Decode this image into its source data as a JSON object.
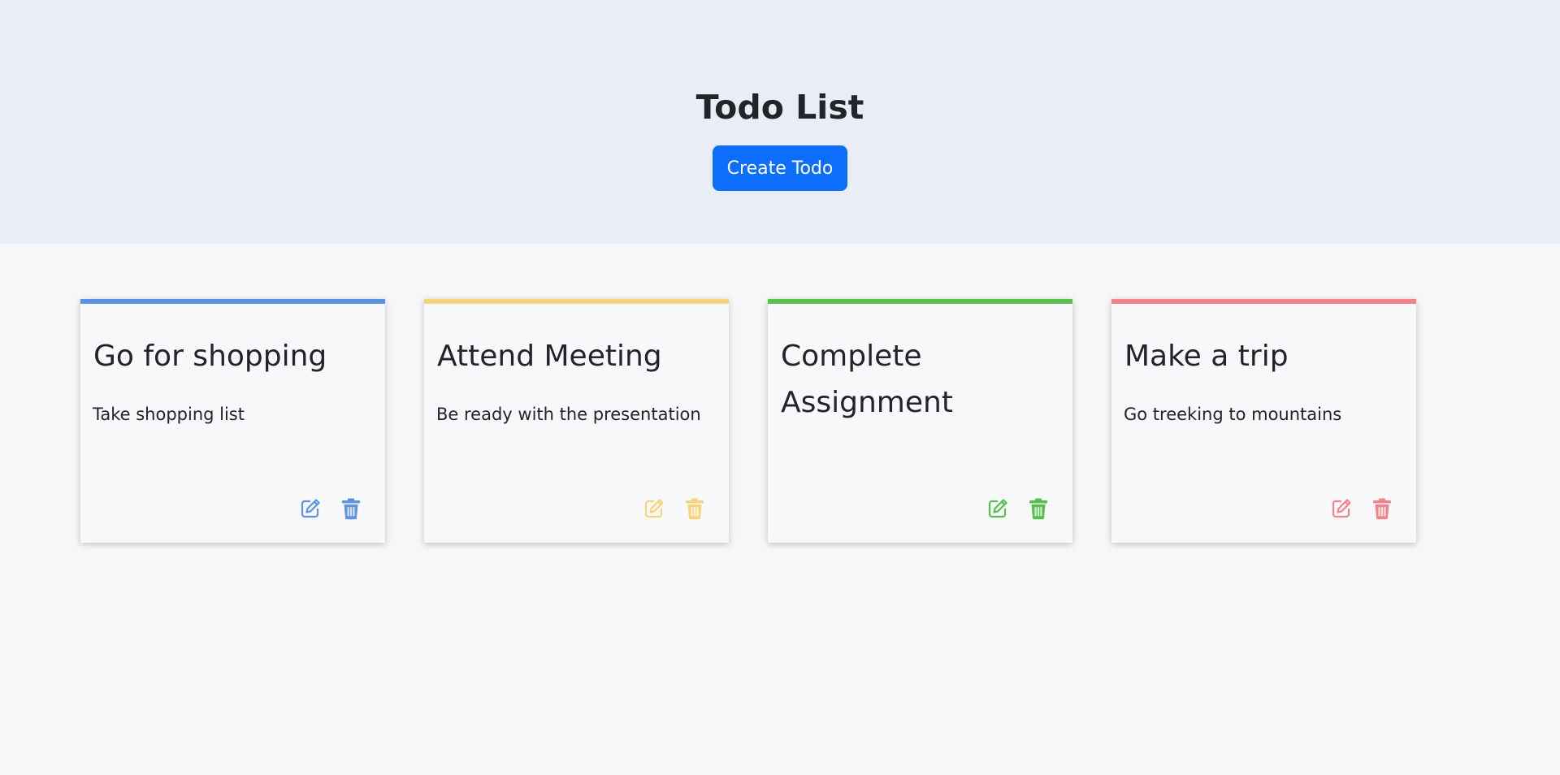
{
  "header": {
    "title": "Todo List",
    "create_label": "Create Todo"
  },
  "todos": [
    {
      "title": "Go for shopping",
      "description": "Take shopping list",
      "color": "#5b93e0",
      "edit_icon": "edit-icon",
      "delete_icon": "trash-icon"
    },
    {
      "title": "Attend Meeting",
      "description": "Be ready with the presentation",
      "color": "#f7d47c",
      "edit_icon": "edit-icon",
      "delete_icon": "trash-icon"
    },
    {
      "title": "Complete Assignment",
      "description": "",
      "color": "#56c04f",
      "edit_icon": "edit-icon",
      "delete_icon": "trash-icon"
    },
    {
      "title": "Make a trip",
      "description": "Go treeking to mountains",
      "color": "#f0838b",
      "edit_icon": "edit-icon",
      "delete_icon": "trash-icon"
    }
  ],
  "colors": {
    "header_bg": "#e9edf5",
    "page_bg": "#f6f7f9",
    "primary_button": "#0d6efd"
  }
}
